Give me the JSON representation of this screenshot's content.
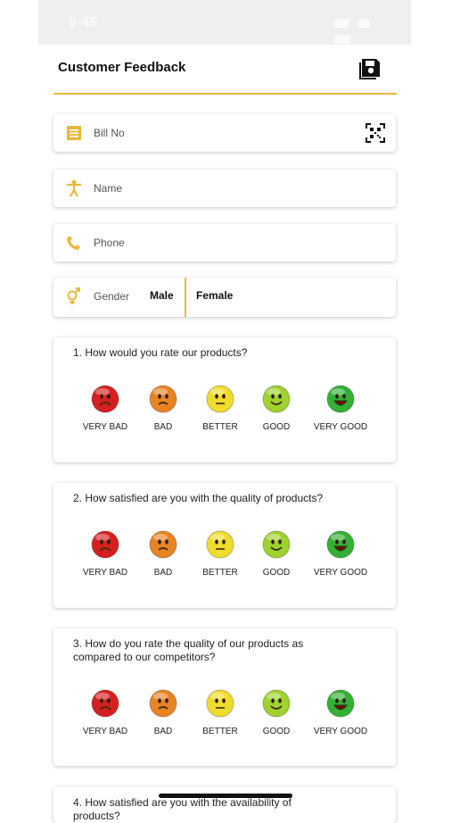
{
  "status": {
    "time": "6:45"
  },
  "header": {
    "title": "Customer Feedback",
    "save_icon": "save-icon"
  },
  "form": {
    "bill_label": "Bill No",
    "name_label": "Name",
    "phone_label": "Phone",
    "gender_label": "Gender",
    "gender_options": [
      "Male",
      "Female"
    ]
  },
  "rating_labels": [
    "VERY BAD",
    "BAD",
    "BETTER",
    "GOOD",
    "VERY GOOD"
  ],
  "questions": [
    {
      "text": "1. How would you rate our products?"
    },
    {
      "text": "2. How satisfied are you with the quality of products?"
    },
    {
      "text": "3. How do you rate the quality of our products as compared to our competitors?"
    },
    {
      "text": "4. How satisfied are you with the availability of products?"
    }
  ],
  "colors": {
    "accent": "#e9b93b",
    "very_bad": "#d62020",
    "bad": "#e88424",
    "better": "#f0dc2c",
    "good": "#9ed22e",
    "very_good": "#34b034"
  }
}
